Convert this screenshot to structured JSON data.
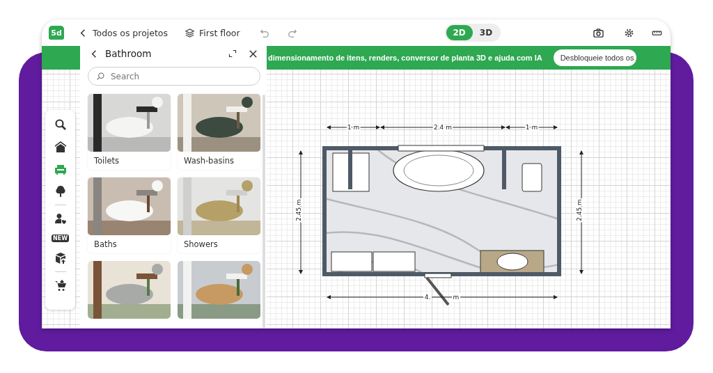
{
  "topbar": {
    "logo": "5d",
    "back_link": "Todos os projetos",
    "floor": "First floor",
    "view_modes": [
      {
        "label": "2D",
        "selected": true
      },
      {
        "label": "3D",
        "selected": false
      }
    ]
  },
  "banner": {
    "text": "dimensionamento de itens, renders, conversor de planta 3D e ajuda com IA",
    "button": "Desbloqueie todos os"
  },
  "tool_rail": [
    {
      "kind": "search",
      "selected": false
    },
    {
      "kind": "home",
      "selected": false
    },
    {
      "kind": "sofa",
      "selected": true
    },
    {
      "kind": "tree",
      "selected": false
    },
    {
      "kind": "divider"
    },
    {
      "kind": "person",
      "selected": false
    },
    {
      "kind": "new",
      "badge": "NEW",
      "selected": false
    },
    {
      "kind": "box",
      "selected": false
    },
    {
      "kind": "divider"
    },
    {
      "kind": "cart",
      "selected": false
    }
  ],
  "panel": {
    "title": "Bathroom",
    "search": {
      "placeholder": "Search"
    },
    "categories": [
      {
        "kind": "picture",
        "label": "Toilets"
      },
      {
        "kind": "picture",
        "label": "Wash-basins"
      },
      {
        "kind": "picture",
        "label": "Baths"
      },
      {
        "kind": "picture",
        "label": "Showers"
      },
      {
        "kind": "picture"
      },
      {
        "kind": "picture"
      }
    ]
  },
  "plan": {
    "top_dimensions": [
      "1 m",
      "2.4 m",
      "1 m"
    ],
    "left_dimension": "2.45 m",
    "right_dimension": "2.45 m",
    "bottom_dimension": {
      "before_door": "4.",
      "after_door": "m"
    }
  }
}
